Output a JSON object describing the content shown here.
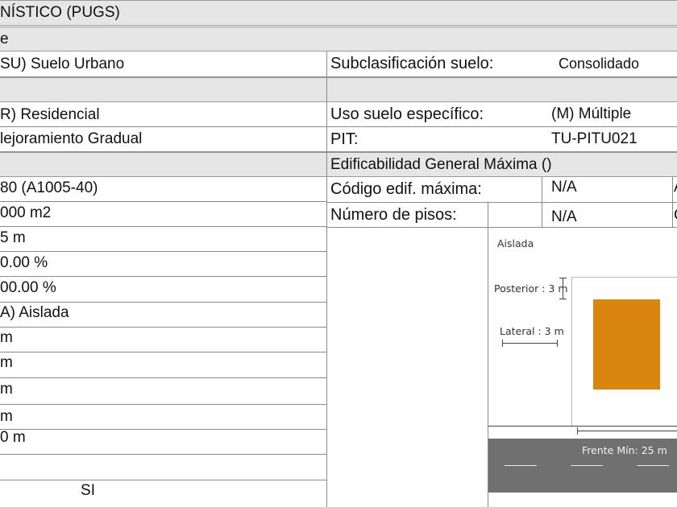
{
  "header": {
    "title": "NÍSTICO (PUGS)"
  },
  "section_row": {
    "label": "e"
  },
  "left_values": [
    "SU) Suelo Urbano",
    "",
    "R) Residencial",
    "lejoramiento Gradual",
    "",
    "80 (A1005-40)",
    "000 m2",
    "5 m",
    "0.00 %",
    "00.00 %",
    "A) Aislada",
    " m",
    " m",
    " m",
    " m",
    "0 m",
    "",
    "SI"
  ],
  "right_rows": {
    "subclasificacion_label": "Subclasificación suelo:",
    "subclasificacion_value": "Consolidado",
    "uso_especifico_label": "Uso suelo específico:",
    "uso_especifico_value": "(M) Múltiple",
    "pit_label": "PIT:",
    "pit_value": "TU-PITU021",
    "edificabilidad_title": "Edificabilidad General Máxima ()",
    "codigo_label": "Código edif. máxima:",
    "codigo_value": "N/A",
    "codigo_extra": "A",
    "pisos_label": "Número de pisos:",
    "pisos_value": "N/A",
    "pisos_extra": "C"
  },
  "diagram": {
    "type_label": "Aislada",
    "posterior_label": "Posterior : 3 m",
    "lateral_label": "Lateral : 3 m",
    "frente_label": "Frente Mín: 25 m",
    "building_color": "#d9860f",
    "street_color": "#707070"
  }
}
